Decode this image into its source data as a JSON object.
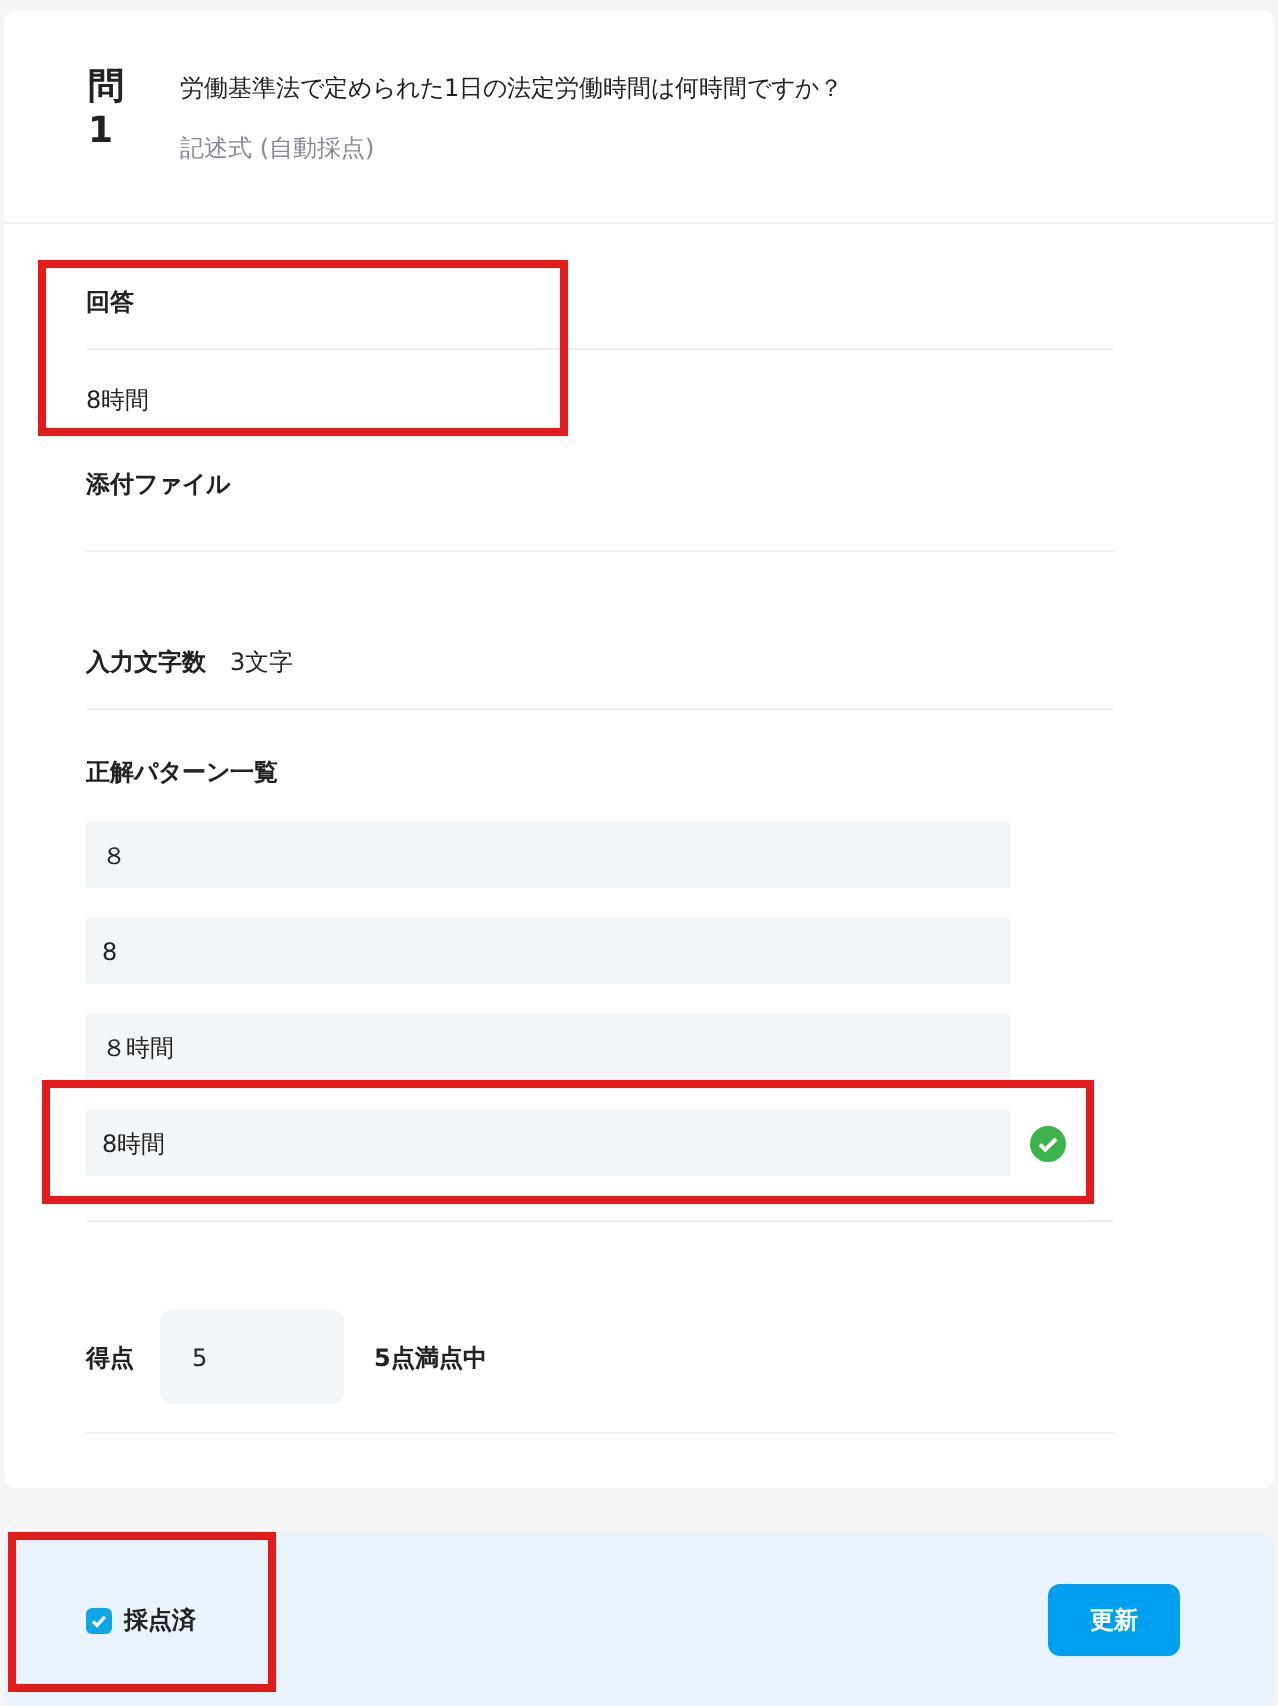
{
  "question": {
    "label": "問",
    "number": "1",
    "text": "労働基準法で定められた1日の法定労働時間は何時間ですか？",
    "type": "記述式 (自動採点)"
  },
  "answer": {
    "label": "回答",
    "value": "8時間",
    "highlighted": true
  },
  "attachment": {
    "label": "添付ファイル"
  },
  "char_count": {
    "label": "入力文字数",
    "value": "3文字"
  },
  "patterns": {
    "label": "正解パターン一覧",
    "items": [
      {
        "value": "８",
        "matched": false,
        "highlighted": false
      },
      {
        "value": "8",
        "matched": false,
        "highlighted": false
      },
      {
        "value": "８時間",
        "matched": false,
        "highlighted": false
      },
      {
        "value": "8時間",
        "matched": true,
        "highlighted": true
      }
    ]
  },
  "score": {
    "label": "得点",
    "value": "5",
    "max": "5点満点中"
  },
  "graded": {
    "label": "採点済",
    "checked": true,
    "highlighted": true
  },
  "update_button": "更新"
}
